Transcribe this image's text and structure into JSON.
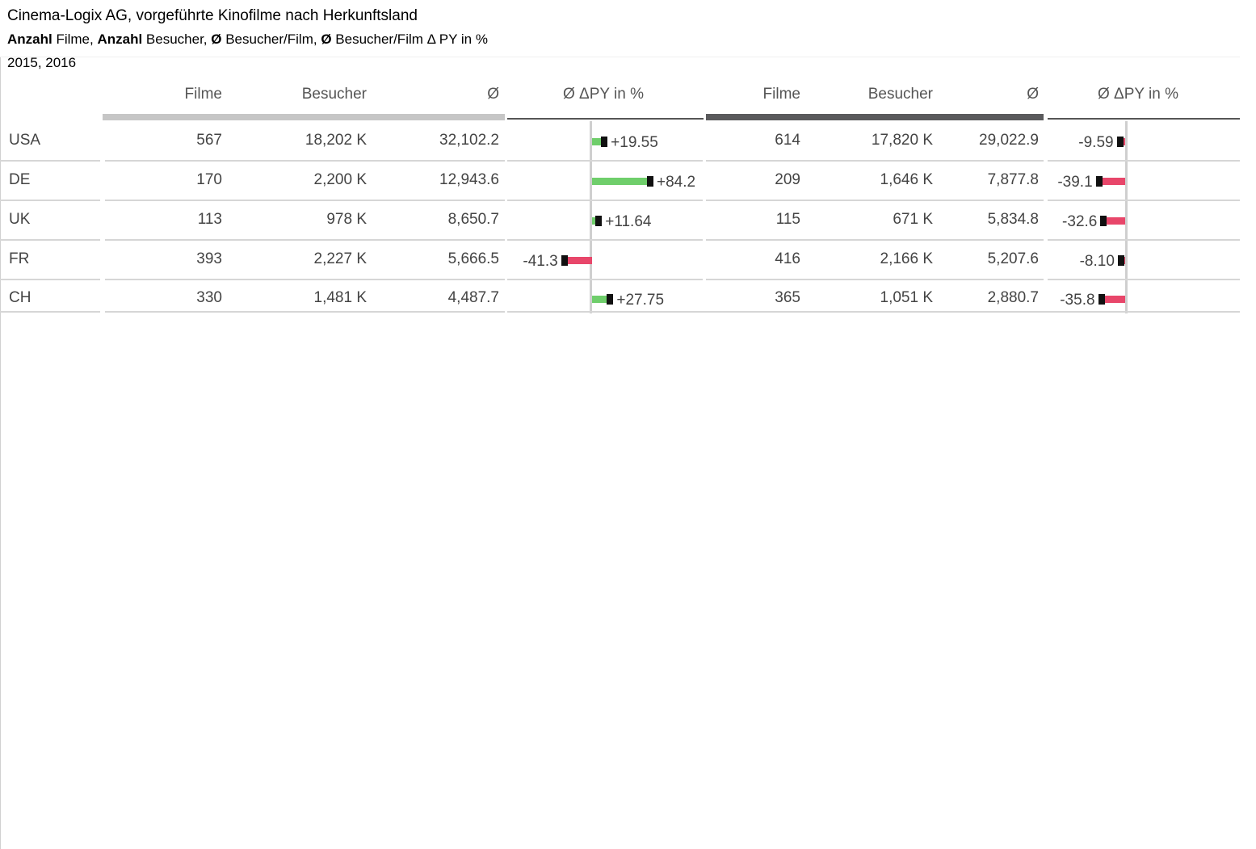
{
  "header": {
    "title": "Cinema-Logix AG, vorgeführte Kinofilme nach Herkunftsland",
    "subtitle_parts": [
      {
        "bold": "Anzahl",
        "text": " Filme, "
      },
      {
        "bold": "Anzahl",
        "text": " Besucher, "
      },
      {
        "bold": "Ø",
        "text": " Besucher/Film, "
      },
      {
        "bold": "Ø",
        "text": " Besucher/Film Δ PY in %"
      }
    ],
    "years": "2015, 2016"
  },
  "colors": {
    "positive": "#6fce6b",
    "negative": "#e8466a",
    "prior_year_mark": "#111111",
    "bar_2015": "#c6c6c6",
    "bar_2016": "#5a5a5c"
  },
  "columns": {
    "filme": "Filme",
    "besucher": "Besucher",
    "avg": "Ø",
    "delta": "Ø  ΔPY in %"
  },
  "rows": [
    {
      "country": "USA",
      "y2015": {
        "filme": "567",
        "besucher": "18,202 K",
        "avg": "32,102.2",
        "delta": 19.55,
        "delta_label": "+19.55"
      },
      "y2016": {
        "filme": "614",
        "besucher": "17,820 K",
        "avg": "29,022.9",
        "delta": -9.59,
        "delta_label": "-9.59"
      }
    },
    {
      "country": "DE",
      "y2015": {
        "filme": "170",
        "besucher": "2,200 K",
        "avg": "12,943.6",
        "delta": 84.2,
        "delta_label": "+84.2"
      },
      "y2016": {
        "filme": "209",
        "besucher": "1,646 K",
        "avg": "7,877.8",
        "delta": -39.1,
        "delta_label": "-39.1"
      }
    },
    {
      "country": "UK",
      "y2015": {
        "filme": "113",
        "besucher": "978 K",
        "avg": "8,650.7",
        "delta": 11.64,
        "delta_label": "+11.64"
      },
      "y2016": {
        "filme": "115",
        "besucher": "671 K",
        "avg": "5,834.8",
        "delta": -32.6,
        "delta_label": "-32.6"
      }
    },
    {
      "country": "FR",
      "y2015": {
        "filme": "393",
        "besucher": "2,227 K",
        "avg": "5,666.5",
        "delta": -41.3,
        "delta_label": "-41.3"
      },
      "y2016": {
        "filme": "416",
        "besucher": "2,166 K",
        "avg": "5,207.6",
        "delta": -8.1,
        "delta_label": "-8.10"
      }
    },
    {
      "country": "CH",
      "y2015": {
        "filme": "330",
        "besucher": "1,481 K",
        "avg": "4,487.7",
        "delta": 27.75,
        "delta_label": "+27.75"
      },
      "y2016": {
        "filme": "365",
        "besucher": "1,051 K",
        "avg": "2,880.7",
        "delta": -35.8,
        "delta_label": "-35.8"
      }
    }
  ]
}
